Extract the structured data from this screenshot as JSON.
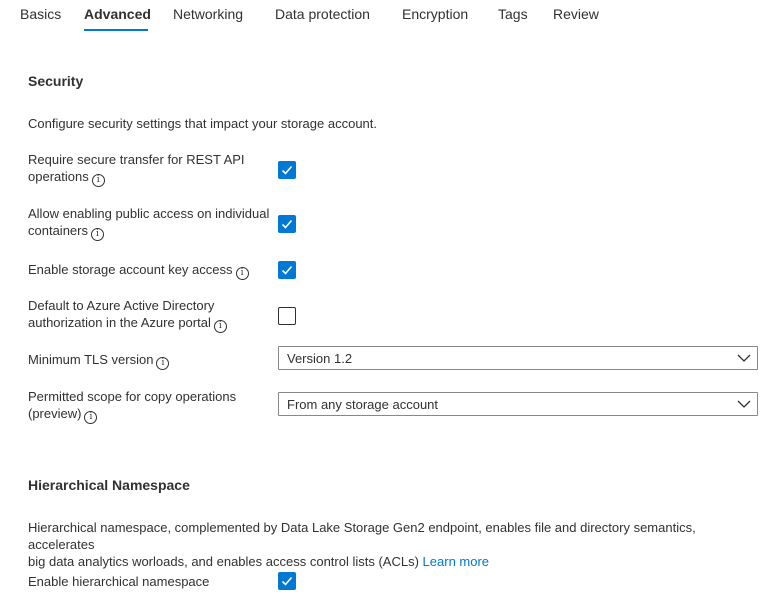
{
  "tabs": [
    {
      "label": "Basics"
    },
    {
      "label": "Advanced"
    },
    {
      "label": "Networking"
    },
    {
      "label": "Data protection"
    },
    {
      "label": "Encryption"
    },
    {
      "label": "Tags"
    },
    {
      "label": "Review"
    }
  ],
  "active_tab": "Advanced",
  "security": {
    "title": "Security",
    "description": "Configure security settings that impact your storage account.",
    "settings": [
      {
        "label_line1": "Require secure transfer for REST API",
        "label_line2": "operations",
        "checked": true
      },
      {
        "label_line1": "Allow enabling public access on individual",
        "label_line2": "containers",
        "checked": true
      },
      {
        "label_line1": "Enable storage account key access",
        "checked": true
      },
      {
        "label_line1": "Default to Azure Active Directory",
        "label_line2": "authorization in the Azure portal",
        "checked": false
      }
    ],
    "tls": {
      "label": "Minimum TLS version",
      "value": "Version 1.2"
    },
    "copy_scope": {
      "label_line1": "Permitted scope for copy operations",
      "label_line2": "(preview)",
      "value": "From any storage account"
    }
  },
  "hns": {
    "title": "Hierarchical Namespace",
    "description_line1": "Hierarchical namespace, complemented by Data Lake Storage Gen2 endpoint, enables file and directory semantics, accelerates",
    "description_line2": "big data analytics worloads, and enables access control lists (ACLs)",
    "learn_more": "Learn more",
    "enable_label": "Enable hierarchical namespace",
    "enable_checked": true
  },
  "colors": {
    "accent": "#0078d4",
    "text": "#323130",
    "border": "#8a8886"
  },
  "icons": [
    "info-icon",
    "checkmark-icon",
    "chevron-down-icon"
  ]
}
